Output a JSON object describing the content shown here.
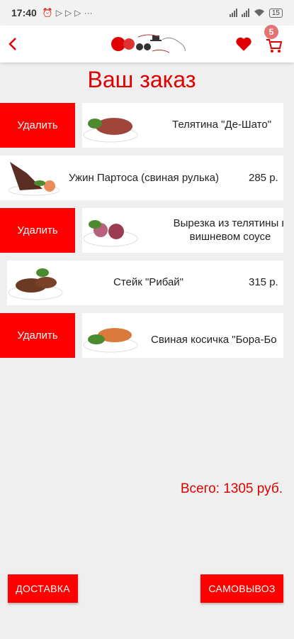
{
  "status_bar": {
    "time": "17:40",
    "battery": "15",
    "more": "···"
  },
  "header": {
    "cart_count": "5"
  },
  "page_title": "Ваш заказ",
  "delete_label": "Удалить",
  "items": [
    {
      "name": "Телятина \"Де-Шато\"",
      "price": ""
    },
    {
      "name": "Ужин Партоса (свиная рулька)",
      "price": "285 р."
    },
    {
      "name": "Вырезка из телятины в вишневом соусе",
      "price": ""
    },
    {
      "name": "Стейк \"Рибай\"",
      "price": "315 р."
    },
    {
      "name": "Свиная косичка \"Бора-Бо",
      "price": ""
    }
  ],
  "total": "Всего: 1305 руб.",
  "buttons": {
    "delivery": "ДОСТАВКА",
    "pickup": "САМОВЫВОЗ"
  },
  "colors": {
    "accent": "#ff0000",
    "title": "#e00000",
    "badge": "#e57373",
    "background": "#efefef"
  }
}
